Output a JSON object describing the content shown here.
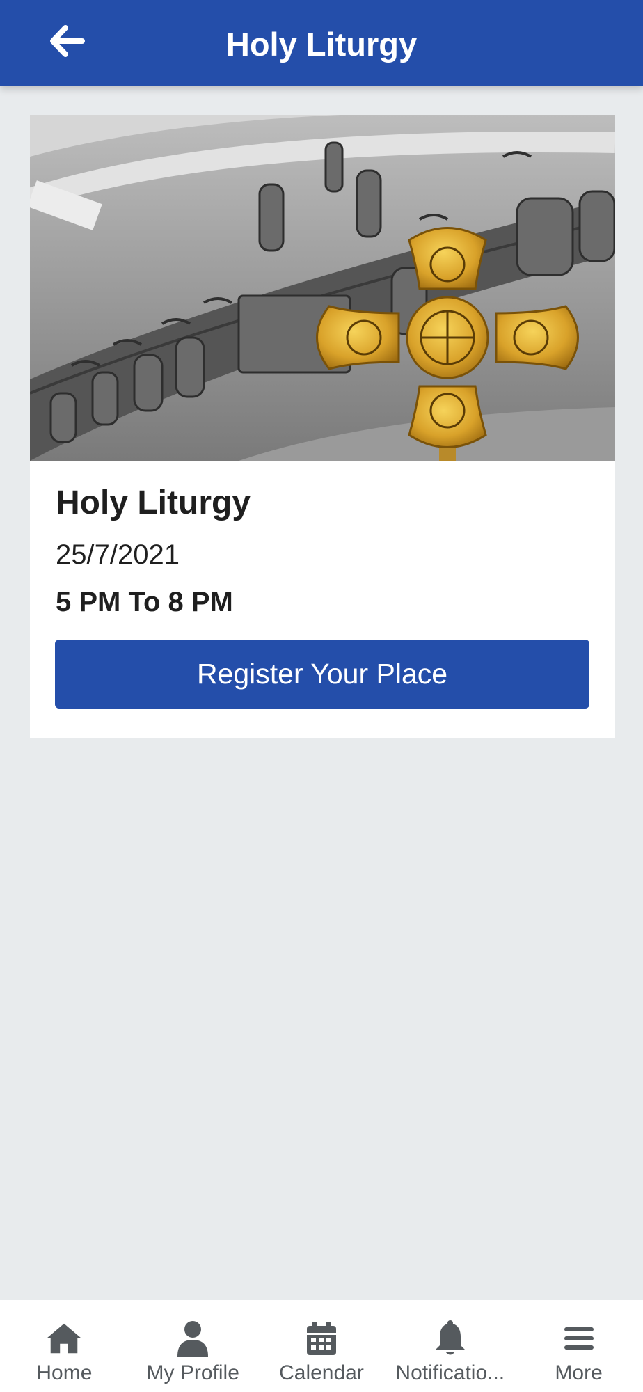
{
  "appbar": {
    "title": "Holy Liturgy",
    "back_icon": "arrow-left-icon"
  },
  "event": {
    "image_description": "Golden cross in church",
    "title": "Holy Liturgy",
    "date": "25/7/2021",
    "time": "5 PM To 8 PM",
    "register_label": "Register Your Place"
  },
  "bottom_nav": {
    "items": [
      {
        "label": "Home",
        "icon": "home-icon"
      },
      {
        "label": "My Profile",
        "icon": "user-icon"
      },
      {
        "label": "Calendar",
        "icon": "calendar-icon"
      },
      {
        "label": "Notificatio...",
        "icon": "bell-icon"
      },
      {
        "label": "More",
        "icon": "menu-icon"
      }
    ]
  },
  "colors": {
    "primary": "#244eaa",
    "background": "#e8ebed",
    "nav_text": "#555a5e"
  }
}
